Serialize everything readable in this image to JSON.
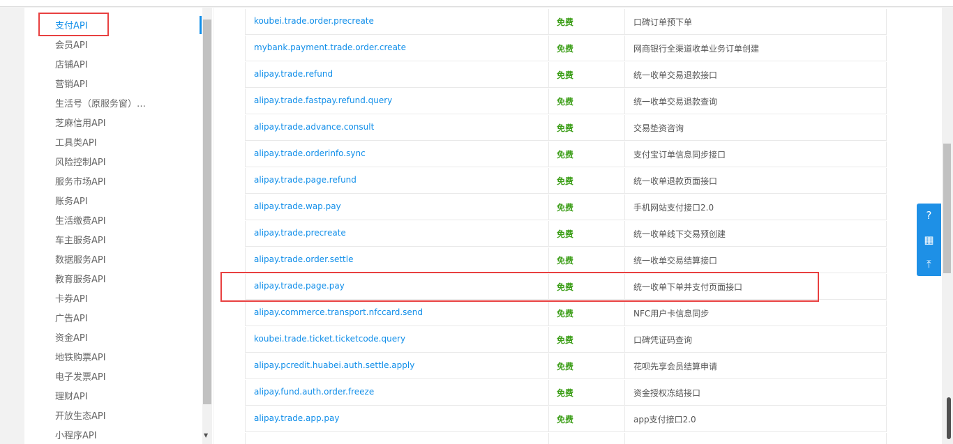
{
  "sidebar": {
    "items": [
      "支付API",
      "会员API",
      "店铺API",
      "营销API",
      "生活号（原服务窗）…",
      "芝麻信用API",
      "工具类API",
      "风险控制API",
      "服务市场API",
      "账务API",
      "生活缴费API",
      "车主服务API",
      "数据服务API",
      "教育服务API",
      "卡券API",
      "广告API",
      "资金API",
      "地铁购票API",
      "电子发票API",
      "理财API",
      "开放生态API",
      "小程序API"
    ],
    "active_index": 0
  },
  "table": {
    "rows": [
      {
        "name": "koubei.trade.order.precreate",
        "price": "免费",
        "desc": "口碑订单预下单"
      },
      {
        "name": "mybank.payment.trade.order.create",
        "price": "免费",
        "desc": "网商银行全渠道收单业务订单创建"
      },
      {
        "name": "alipay.trade.refund",
        "price": "免费",
        "desc": "统一收单交易退款接口"
      },
      {
        "name": "alipay.trade.fastpay.refund.query",
        "price": "免费",
        "desc": "统一收单交易退款查询"
      },
      {
        "name": "alipay.trade.advance.consult",
        "price": "免费",
        "desc": "交易垫资咨询"
      },
      {
        "name": "alipay.trade.orderinfo.sync",
        "price": "免费",
        "desc": "支付宝订单信息同步接口"
      },
      {
        "name": "alipay.trade.page.refund",
        "price": "免费",
        "desc": "统一收单退款页面接口"
      },
      {
        "name": "alipay.trade.wap.pay",
        "price": "免费",
        "desc": "手机网站支付接口2.0"
      },
      {
        "name": "alipay.trade.precreate",
        "price": "免费",
        "desc": "统一收单线下交易预创建"
      },
      {
        "name": "alipay.trade.order.settle",
        "price": "免费",
        "desc": "统一收单交易结算接口"
      },
      {
        "name": "alipay.trade.page.pay",
        "price": "免费",
        "desc": "统一收单下单并支付页面接口"
      },
      {
        "name": "alipay.commerce.transport.nfccard.send",
        "price": "免费",
        "desc": "NFC用户卡信息同步"
      },
      {
        "name": "koubei.trade.ticket.ticketcode.query",
        "price": "免费",
        "desc": "口碑凭证码查询"
      },
      {
        "name": "alipay.pcredit.huabei.auth.settle.apply",
        "price": "免费",
        "desc": "花呗先享会员结算申请"
      },
      {
        "name": "alipay.fund.auth.order.freeze",
        "price": "免费",
        "desc": "资金授权冻结接口"
      },
      {
        "name": "alipay.trade.app.pay",
        "price": "免费",
        "desc": "app支付接口2.0"
      }
    ],
    "highlight_index": 10
  },
  "float_tools": [
    {
      "icon": "help-icon",
      "glyph": "?"
    },
    {
      "icon": "qrcode-icon",
      "glyph": "▦"
    },
    {
      "icon": "back-to-top-icon",
      "glyph": "⤒"
    }
  ],
  "colors": {
    "accent": "#108ee9",
    "price": "#3c9e18",
    "highlight": "#e84040"
  }
}
